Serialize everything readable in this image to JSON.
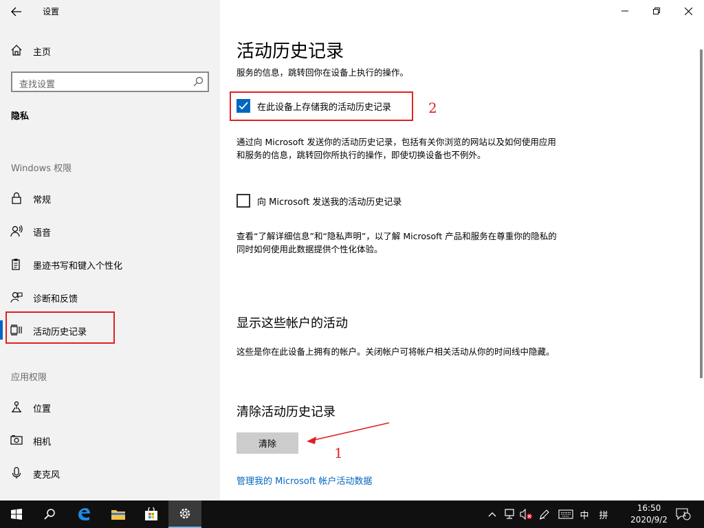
{
  "window": {
    "title": "设置",
    "controls": {
      "minimize": "minimize",
      "maximize": "restore",
      "close": "close"
    }
  },
  "sidebar": {
    "home_label": "主页",
    "search_placeholder": "查找设置",
    "category": "隐私",
    "section_windows": "Windows 权限",
    "windows_items": [
      {
        "label": "常规",
        "icon": "lock-icon"
      },
      {
        "label": "语音",
        "icon": "speech-icon"
      },
      {
        "label": "墨迹书写和键入个性化",
        "icon": "pen-clipboard-icon"
      },
      {
        "label": "诊断和反馈",
        "icon": "feedback-icon"
      },
      {
        "label": "活动历史记录",
        "icon": "activity-history-icon",
        "active": true
      }
    ],
    "section_app": "应用权限",
    "app_items": [
      {
        "label": "位置",
        "icon": "location-icon"
      },
      {
        "label": "相机",
        "icon": "camera-icon"
      },
      {
        "label": "麦克风",
        "icon": "microphone-icon"
      }
    ]
  },
  "main": {
    "title": "活动历史记录",
    "intro": "服务的信息，跳转回你在设备上执行的操作。",
    "store_checkbox": {
      "label": "在此设备上存储我的活动历史记录",
      "checked": true
    },
    "send_desc": "通过向 Microsoft 发送你的活动历史记录，包括有关你浏览的网站以及如何使用应用和服务的信息，跳转回你所执行的操作，即使切换设备也不例外。",
    "send_checkbox": {
      "label": "向 Microsoft 发送我的活动历史记录",
      "checked": false
    },
    "privacy_desc": "查看“了解详细信息”和“隐私声明”，以了解 Microsoft 产品和服务在尊重你的隐私的同时如何使用此数据提供个性化体验。",
    "accounts_heading": "显示这些帐户的活动",
    "accounts_desc": "这些是你在此设备上拥有的帐户。关闭帐户可将帐户相关活动从你的时间线中隐藏。",
    "clear_heading": "清除活动历史记录",
    "clear_button": "清除",
    "manage_link": "管理我的 Microsoft 帐户活动数据"
  },
  "annotations": {
    "one": "1",
    "two": "2",
    "color": "#e02020"
  },
  "taskbar": {
    "ime_lang": "中",
    "ime_mode": "拼",
    "time": "16:50",
    "date": "2020/9/2",
    "notification_count": "1"
  },
  "colors": {
    "accent": "#0067c0",
    "sidebar_bg": "#f2f2f2",
    "taskbar_bg": "#101010"
  }
}
